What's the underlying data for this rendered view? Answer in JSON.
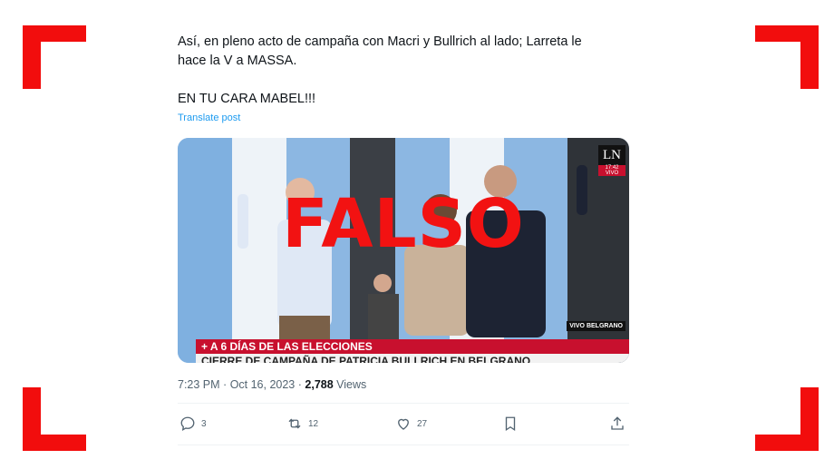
{
  "tweet": {
    "text_line1": "Así, en pleno acto de campaña con Macri y Bullrich al lado; Larreta le",
    "text_line2": "hace la V a MASSA.",
    "text_line3": "EN TU CARA MABEL!!!",
    "translate_label": "Translate post"
  },
  "media": {
    "overlay_label": "FALSO",
    "chyron_top": "+ A 6 DÍAS DE LAS ELECCIONES",
    "chyron_bottom": "CIERRE DE CAMPAÑA DE PATRICIA BULLRICH EN BELGRANO",
    "channel_logo": "LN",
    "channel_time": "17:42",
    "channel_live": "VIVO",
    "location_tag": "VIVO BELGRANO"
  },
  "meta": {
    "time": "7:23 PM",
    "date": "Oct 16, 2023",
    "views_count": "2,788",
    "views_label": "Views"
  },
  "actions": {
    "replies": "3",
    "reposts": "12",
    "likes": "27"
  },
  "icons": [
    "reply-icon",
    "repost-icon",
    "like-icon",
    "bookmark-icon",
    "share-icon"
  ],
  "colors": {
    "frame_red": "#f20d0d",
    "falso_red": "#f21212",
    "link_blue": "#1d9bf0",
    "muted": "#536471",
    "text": "#0f1419"
  }
}
